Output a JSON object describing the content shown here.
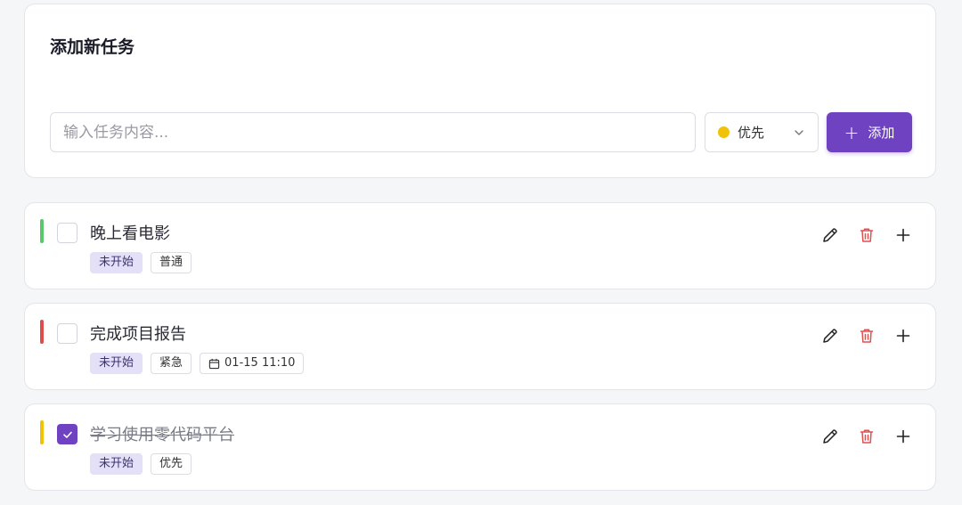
{
  "colors": {
    "accent": "#6f42c1",
    "priority_normal": "#5ac86a",
    "priority_urgent": "#e04b4b",
    "priority_high": "#f0c20a",
    "delete_red": "#e05050"
  },
  "add_form": {
    "title": "添加新任务",
    "input_placeholder": "输入任务内容...",
    "input_value": "",
    "priority_selected": "优先",
    "priority_dot_color": "#f0c20a",
    "priority_icon": "chevron-down-icon",
    "add_button_label": "添加",
    "add_button_icon": "plus-icon"
  },
  "tasks": [
    {
      "title": "晚上看电影",
      "done": false,
      "priority_color": "#5ac86a",
      "tags": {
        "status": "未开始",
        "priority": "普通",
        "due": ""
      }
    },
    {
      "title": "完成项目报告",
      "done": false,
      "priority_color": "#e04b4b",
      "tags": {
        "status": "未开始",
        "priority": "紧急",
        "due": "01-15 11:10"
      }
    },
    {
      "title": "学习使用零代码平台",
      "done": true,
      "priority_color": "#f0c20a",
      "tags": {
        "status": "未开始",
        "priority": "优先",
        "due": ""
      }
    }
  ],
  "task_action_icons": [
    "edit-icon",
    "delete-icon",
    "add-subtask-icon"
  ]
}
